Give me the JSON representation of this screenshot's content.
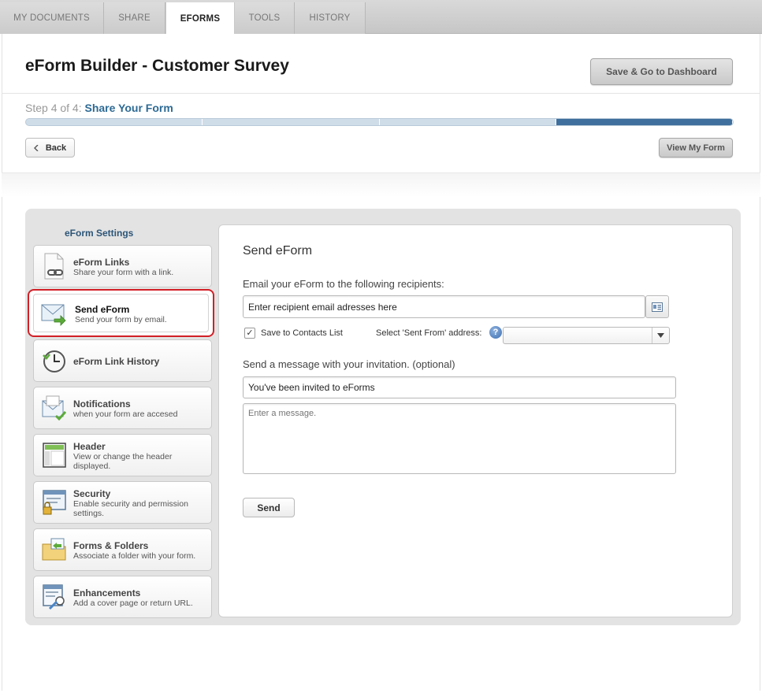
{
  "tabs": [
    {
      "label": "MY DOCUMENTS",
      "active": false
    },
    {
      "label": "SHARE",
      "active": false
    },
    {
      "label": "EFORMS",
      "active": true
    },
    {
      "label": "TOOLS",
      "active": false
    },
    {
      "label": "HISTORY",
      "active": false
    }
  ],
  "header": {
    "title": "eForm Builder - Customer Survey",
    "save_button": "Save & Go to Dashboard"
  },
  "wizard": {
    "step_prefix": "Step 4 of 4:",
    "step_name": "Share Your Form",
    "current_step": 4,
    "total_steps": 4,
    "back_button": "Back",
    "view_button": "View My Form"
  },
  "sidebar": {
    "title": "eForm Settings",
    "items": [
      {
        "label": "eForm Links",
        "sub": "Share your form with a link.",
        "icon": "link-document-icon"
      },
      {
        "label": "Send eForm",
        "sub": "Send your form by email.",
        "icon": "envelope-arrow-icon",
        "active": true
      },
      {
        "label": "eForm Link History",
        "sub": "",
        "icon": "clock-history-icon"
      },
      {
        "label": "Notifications",
        "sub": "when your form are accesed",
        "icon": "notification-mail-icon"
      },
      {
        "label": "Header",
        "sub": "View or change the header displayed.",
        "icon": "header-layout-icon"
      },
      {
        "label": "Security",
        "sub": "Enable security and permission settings.",
        "icon": "security-lock-icon"
      },
      {
        "label": "Forms & Folders",
        "sub": "Associate a folder with your form.",
        "icon": "folder-icon"
      },
      {
        "label": "Enhancements",
        "sub": "Add a cover page or return URL.",
        "icon": "enhancement-page-icon"
      }
    ]
  },
  "send": {
    "heading": "Send eForm",
    "recipients_label": "Email your eForm to the following recipients:",
    "recipients_value": "Enter recipient email adresses here",
    "save_contacts_label": "Save to Contacts List",
    "save_contacts_checked": true,
    "sent_from_label": "Select 'Sent From' address:",
    "sent_from_value": "",
    "message_label": "Send a message with your invitation. (optional)",
    "subject_value": "You've been invited to eForms",
    "message_placeholder": "Enter a message.",
    "send_button": "Send"
  },
  "colors": {
    "accent": "#2d6a94",
    "progress_fill": "#3f6f9c",
    "highlight": "#d21f26"
  }
}
